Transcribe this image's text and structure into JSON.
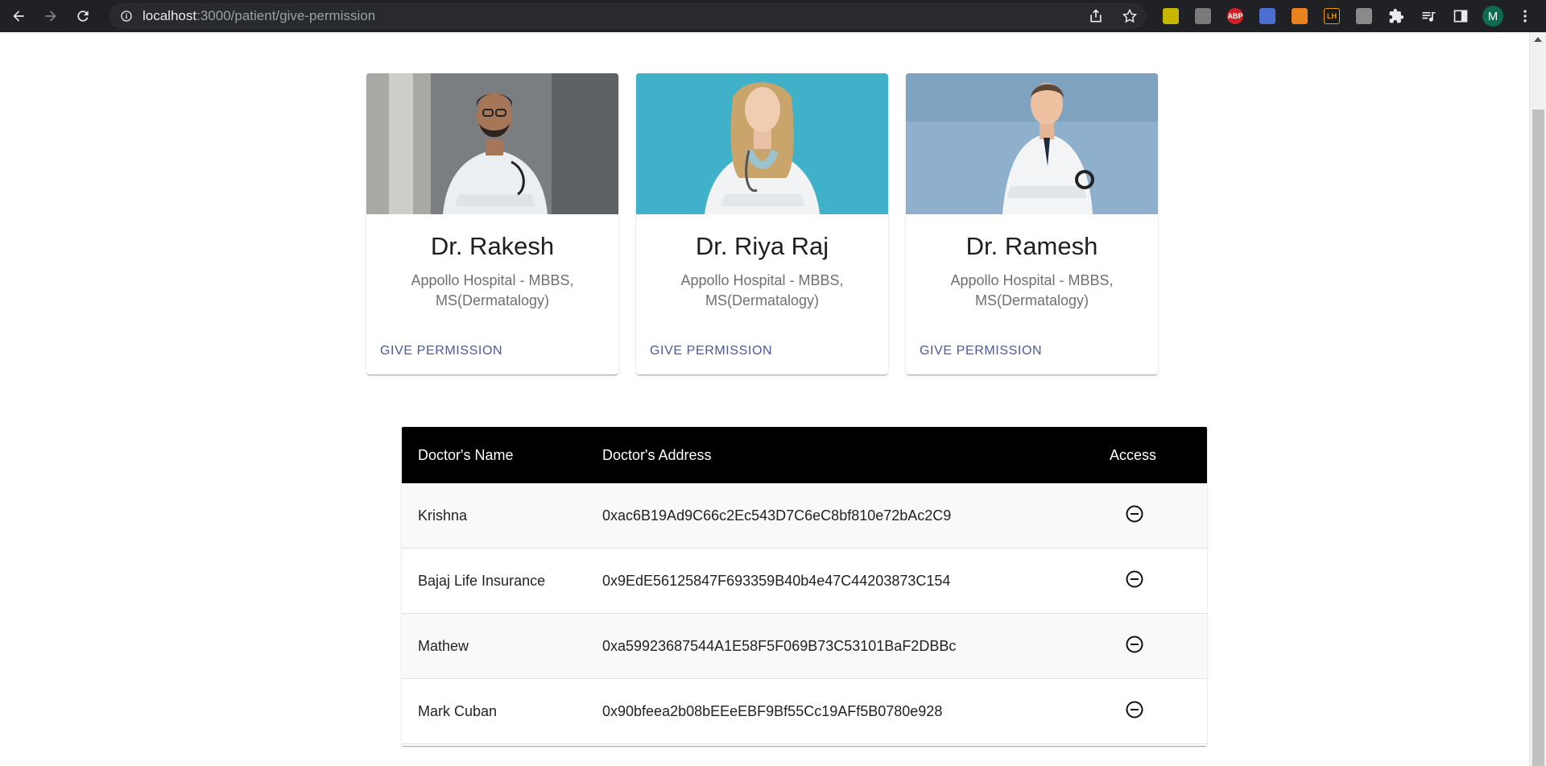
{
  "browser": {
    "url_host": "localhost",
    "url_rest": ":3000/patient/give-permission",
    "avatar_letter": "M",
    "extensions": [
      "ext-yellow",
      "ext-gray",
      "ABP",
      "ext-blue",
      "ext-fox",
      "LH",
      "ext-doc"
    ]
  },
  "doctors": [
    {
      "name": "Dr. Rakesh",
      "subtitle": "Appollo Hospital - MBBS, MS(Dermatalogy)",
      "action": "GIVE PERMISSION"
    },
    {
      "name": "Dr. Riya Raj",
      "subtitle": "Appollo Hospital - MBBS, MS(Dermatalogy)",
      "action": "GIVE PERMISSION"
    },
    {
      "name": "Dr. Ramesh",
      "subtitle": "Appollo Hospital - MBBS, MS(Dermatalogy)",
      "action": "GIVE PERMISSION"
    }
  ],
  "table": {
    "headers": [
      "Doctor's Name",
      "Doctor's Address",
      "Access"
    ],
    "rows": [
      {
        "name": "Krishna",
        "address": "0xac6B19Ad9C66c2Ec543D7C6eC8bf810e72bAc2C9",
        "access_icon": "remove-circle-icon"
      },
      {
        "name": "Bajaj Life Insurance",
        "address": "0x9EdE56125847F693359B40b4e47C44203873C154",
        "access_icon": "remove-circle-icon"
      },
      {
        "name": "Mathew",
        "address": "0xa59923687544A1E58F5F069B73C53101BaF2DBBc",
        "access_icon": "remove-circle-icon"
      },
      {
        "name": "Mark Cuban",
        "address": "0x90bfeea2b08bEEeEBF9Bf55Cc19AFf5B0780e928",
        "access_icon": "remove-circle-icon"
      }
    ]
  },
  "colors": {
    "action": "#4a5a9c",
    "table_header": "#000000",
    "browser_bar": "#202124"
  }
}
